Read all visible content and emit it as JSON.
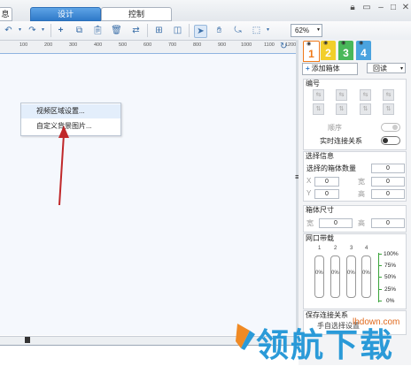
{
  "top_tabs": {
    "partial_left": "息",
    "design": "设计",
    "control": "控制"
  },
  "zoom": {
    "value": "62%"
  },
  "ruler": {
    "ticks": [
      "100",
      "200",
      "300",
      "400",
      "500",
      "600",
      "700",
      "800",
      "900",
      "1000",
      "1100",
      "1200"
    ]
  },
  "context_menu": {
    "items": [
      "视频区域设置...",
      "自定义背景图片..."
    ]
  },
  "layer_tabs": [
    "1",
    "2",
    "3",
    "4"
  ],
  "layer_colors": [
    "#f07a1a",
    "#f2cf2b",
    "#49b85a",
    "#4aa3df"
  ],
  "panel": {
    "add_box_label": "添加箱体",
    "loop_label": "回读",
    "numbering_title": "编号",
    "order_label": "顺序",
    "realtime_connect_label": "实时连接关系",
    "selection_title": "选择信息",
    "selected_count_label": "选择的箱体数量",
    "selected_count_value": "0",
    "x_label": "X",
    "x_value": "0",
    "width_label": "宽",
    "width_value": "0",
    "y_label": "Y",
    "y_value": "0",
    "height_label": "高",
    "height_value": "0",
    "box_size_title": "箱体尺寸",
    "box_width_label": "宽",
    "box_width_value": "0",
    "box_height_label": "高",
    "box_height_value": "0",
    "port_bw_title": "网口带载",
    "port_numbers": [
      "1",
      "2",
      "3",
      "4"
    ],
    "port_values": [
      "0%",
      "0%",
      "0%",
      "0%"
    ],
    "scale": [
      "100%",
      "75%",
      "50%",
      "25%",
      "0%"
    ],
    "save_connect_title": "保存连接关系",
    "save_connect_sub": "手自选择设置"
  },
  "watermark": {
    "text": "领航下载",
    "url": "lhdown.com"
  }
}
